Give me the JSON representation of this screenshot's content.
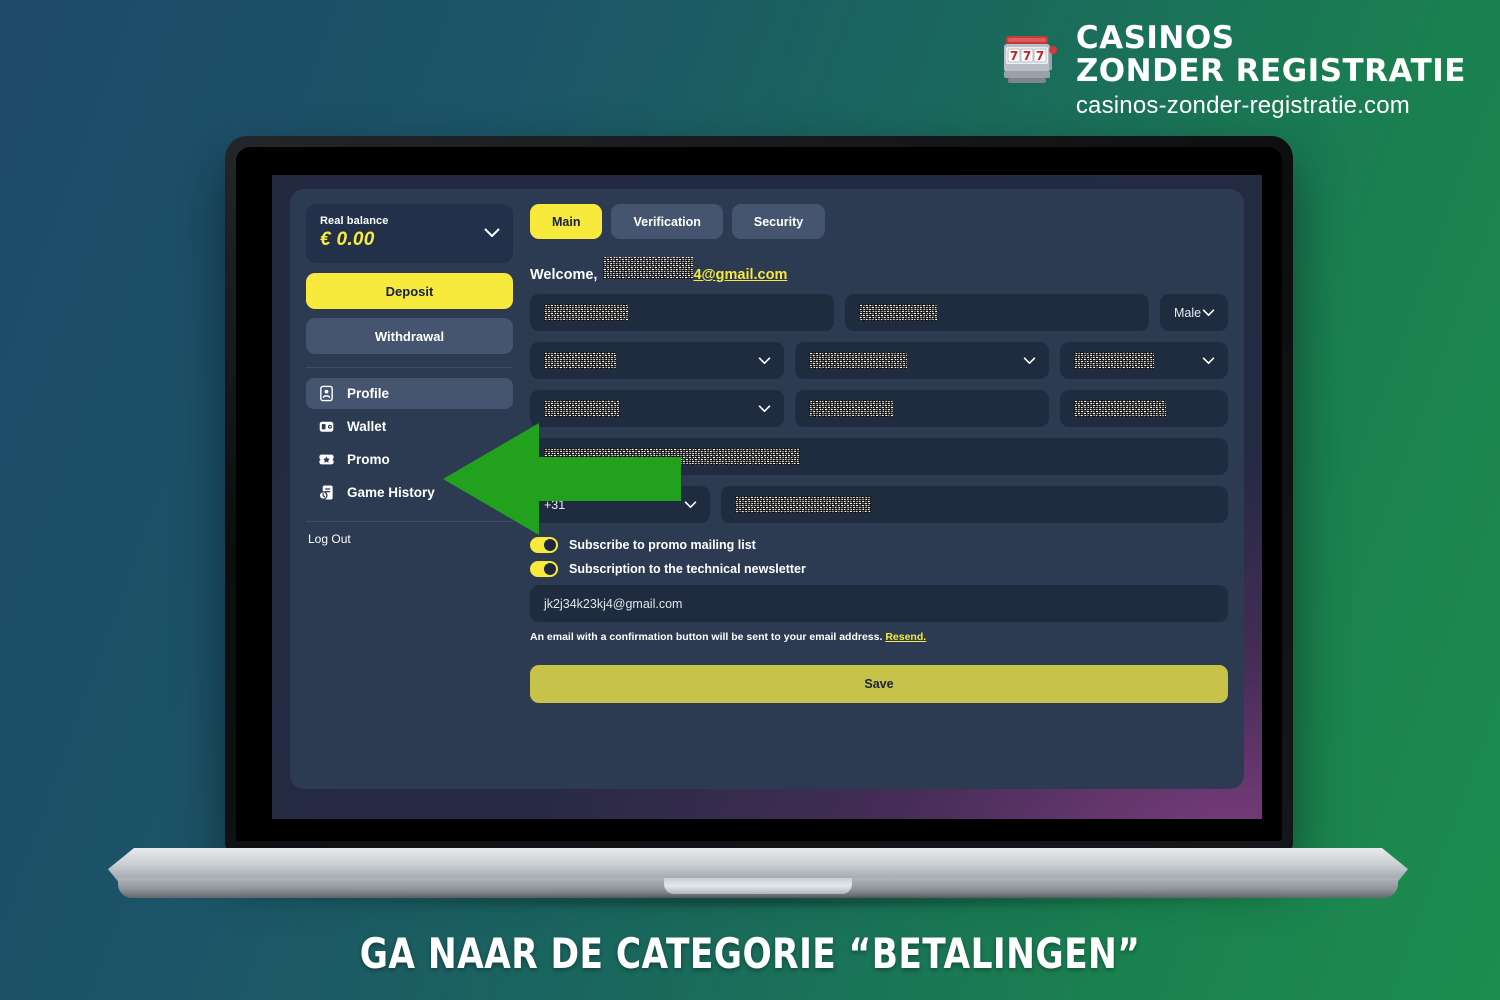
{
  "brand": {
    "logo_icon": "slot-machine-icon",
    "line1": "CASINOS",
    "line2": "ZONDER REGISTRATIE",
    "url": "casinos-zonder-registratie.com"
  },
  "caption": "GA NAAR DE CATEGORIE “BETALINGEN”",
  "colors": {
    "accent_yellow": "#f7ea3c",
    "save_yellow": "#c6c24a",
    "card_bg": "#2c3b52",
    "field_bg": "#1f2c3f",
    "button_muted": "#46556f",
    "arrow_green": "#22a11e",
    "bg_blue": "#1d4a69",
    "bg_green": "#1d8c4d"
  },
  "sidebar": {
    "balance": {
      "label": "Real balance",
      "amount": "€ 0.00",
      "chevron_icon": "chevron-down-icon"
    },
    "deposit_label": "Deposit",
    "withdrawal_label": "Withdrawal",
    "items": [
      {
        "label": "Profile",
        "icon": "profile-card-icon",
        "active": true
      },
      {
        "label": "Wallet",
        "icon": "wallet-icon",
        "active": false
      },
      {
        "label": "Promo",
        "icon": "ticket-star-icon",
        "active": false
      },
      {
        "label": "Game History",
        "icon": "history-document-icon",
        "active": false
      }
    ],
    "logout_label": "Log Out"
  },
  "main": {
    "tabs": [
      {
        "label": "Main",
        "active": true
      },
      {
        "label": "Verification",
        "active": false
      },
      {
        "label": "Security",
        "active": false
      }
    ],
    "welcome": {
      "label": "Welcome,",
      "masked_name": "",
      "email_suffix": "4@gmail.com"
    },
    "form": {
      "row1": [
        {
          "name": "first-name-field",
          "type": "text",
          "value": "",
          "masked": true
        },
        {
          "name": "last-name-field",
          "type": "text",
          "value": "",
          "masked": true
        },
        {
          "name": "gender-select",
          "type": "select",
          "value": "Male",
          "masked": false
        }
      ],
      "row2": [
        {
          "name": "birth-day-select",
          "type": "select",
          "value": "",
          "masked": true
        },
        {
          "name": "birth-month-select",
          "type": "select",
          "value": "",
          "masked": true
        },
        {
          "name": "birth-year-select",
          "type": "select",
          "value": "",
          "masked": true
        }
      ],
      "row3": [
        {
          "name": "country-select",
          "type": "select",
          "value": "",
          "masked": true
        },
        {
          "name": "city-field",
          "type": "text",
          "value": "",
          "masked": true
        },
        {
          "name": "postal-code-field",
          "type": "text",
          "value": "",
          "masked": true
        }
      ],
      "row4": [
        {
          "name": "address-field",
          "type": "text",
          "value": "",
          "masked": true
        }
      ],
      "row5": [
        {
          "name": "phone-country-code-select",
          "type": "select",
          "value": "+31",
          "masked": false
        },
        {
          "name": "phone-number-field",
          "type": "text",
          "value": "",
          "masked": true
        }
      ]
    },
    "toggles": [
      {
        "label": "Subscribe to promo mailing list",
        "on": true
      },
      {
        "label": "Subscription to the technical newsletter",
        "on": true
      }
    ],
    "email_field_value": "jk2j34k23kj4@gmail.com",
    "hint_text": "An email with a confirmation button will be sent to your email address.",
    "hint_link": "Resend.",
    "save_label": "Save"
  },
  "annotation": {
    "arrow_icon": "left-arrow-annotation",
    "points_to": "Wallet"
  }
}
